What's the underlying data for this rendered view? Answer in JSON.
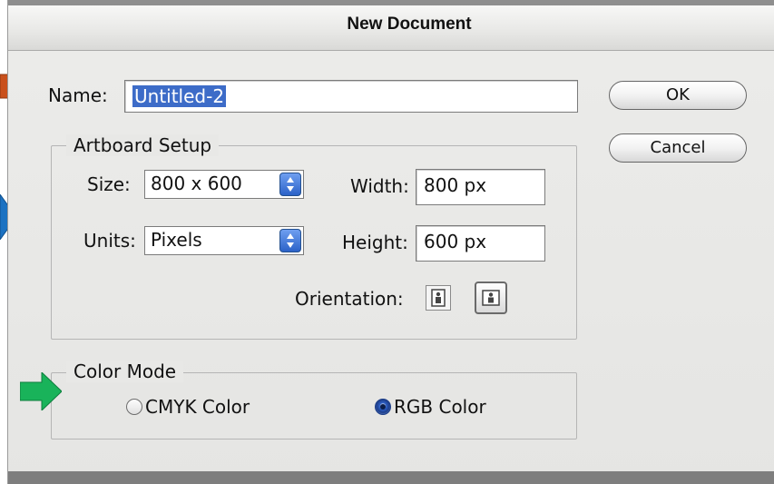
{
  "window": {
    "title": "New Document"
  },
  "name_field": {
    "label": "Name:",
    "value": "Untitled-2"
  },
  "buttons": {
    "ok": "OK",
    "cancel": "Cancel"
  },
  "artboard": {
    "legend": "Artboard Setup",
    "size_label": "Size:",
    "size_value": "800 x 600",
    "width_label": "Width:",
    "width_value": "800 px",
    "units_label": "Units:",
    "units_value": "Pixels",
    "height_label": "Height:",
    "height_value": "600 px",
    "orientation_label": "Orientation:",
    "orientation_selected": "landscape"
  },
  "color_mode": {
    "legend": "Color Mode",
    "options": [
      {
        "label": "CMYK Color",
        "selected": false
      },
      {
        "label": "RGB Color",
        "selected": true
      }
    ]
  },
  "annotations": {
    "colors": {
      "orange": "#c9501c",
      "blue": "#1c72c2",
      "green": "#19b35a"
    }
  }
}
